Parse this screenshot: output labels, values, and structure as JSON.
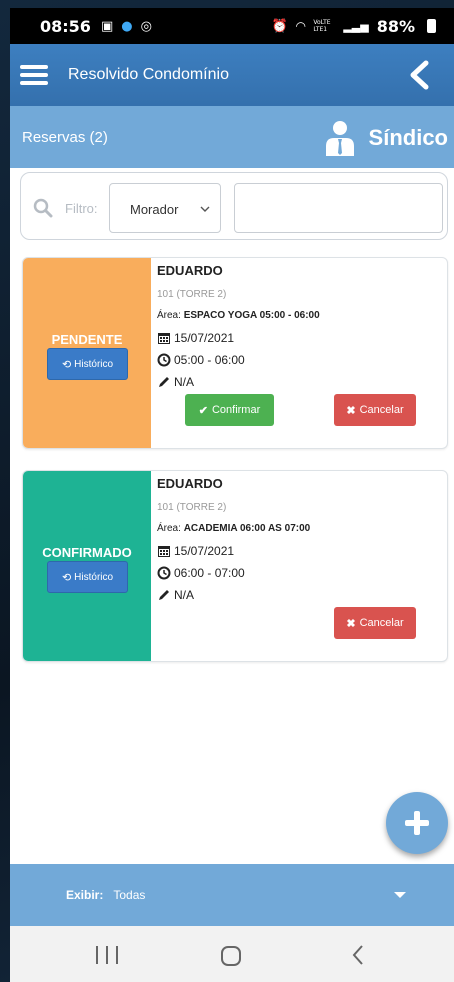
{
  "status_bar": {
    "time": "08:56",
    "battery": "88%",
    "network": "VoLTE LTE1"
  },
  "app": {
    "title": "Resolvido Condomínio"
  },
  "subheader": {
    "reservas_label": "Reservas (2)",
    "role": "Síndico"
  },
  "filter": {
    "label": "Filtro:",
    "select_value": "Morador",
    "text_value": ""
  },
  "reservations": [
    {
      "status": "PENDENTE",
      "status_color": "#f9ad5c",
      "history_label": "Histórico",
      "name": "EDUARDO",
      "unit": "101 (TORRE 2)",
      "area_label": "Área:",
      "area": "ESPACO YOGA 05:00 - 06:00",
      "date": "15/07/2021",
      "time": "05:00 - 06:00",
      "note": "N/A",
      "confirm_label": "Confirmar",
      "cancel_label": "Cancelar"
    },
    {
      "status": "CONFIRMADO",
      "status_color": "#1eb394",
      "history_label": "Histórico",
      "name": "EDUARDO",
      "unit": "101 (TORRE 2)",
      "area_label": "Área:",
      "area": "ACADEMIA 06:00 AS 07:00",
      "date": "15/07/2021",
      "time": "06:00 - 07:00",
      "note": "N/A",
      "cancel_label": "Cancelar"
    }
  ],
  "footer": {
    "exibir_label": "Exibir:",
    "exibir_value": "Todas"
  },
  "colors": {
    "appbar": "#3d7fc0",
    "subbar": "#72a9d8",
    "confirm": "#4db151",
    "cancel": "#d9534f",
    "history": "#3a7bc8"
  }
}
